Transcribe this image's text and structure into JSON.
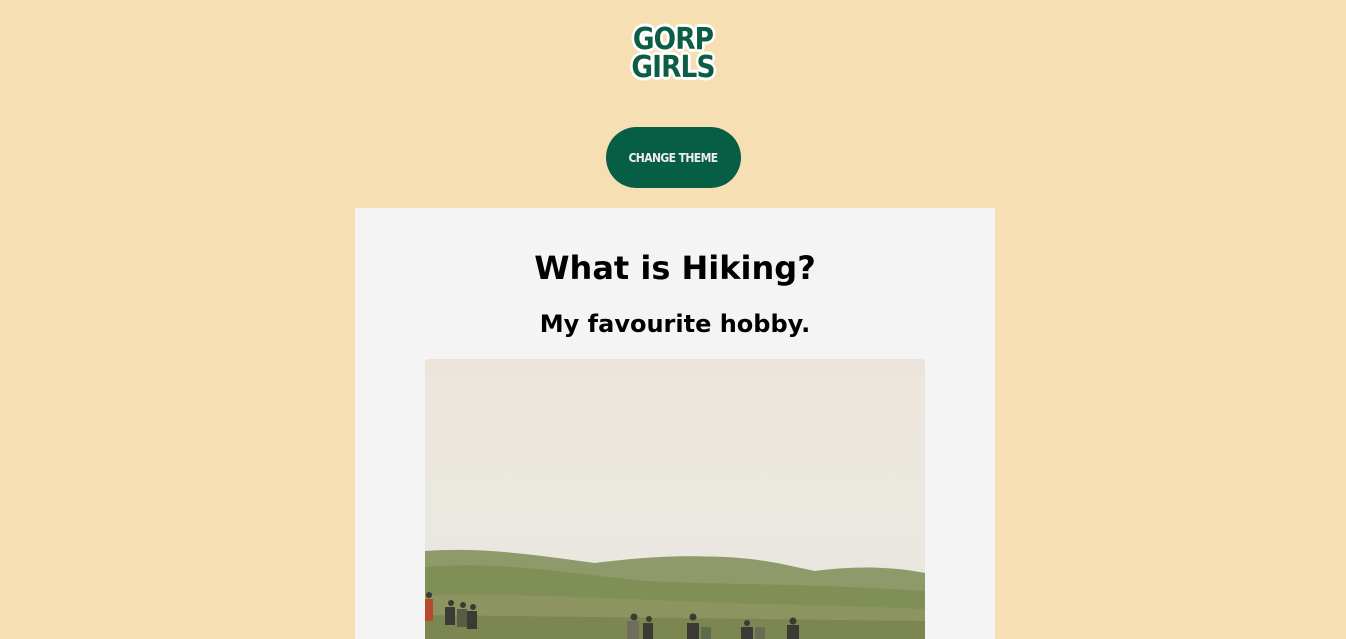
{
  "header": {
    "logo_line1": "GORP",
    "logo_line2": "GIRLS",
    "theme_button_label": "CHANGE THEME"
  },
  "main": {
    "title": "What is Hiking?",
    "subtitle": "My favourite hobby."
  },
  "colors": {
    "page_background": "#f6dfb3",
    "brand_green": "#065e44",
    "card_background": "#f4f4f4"
  }
}
